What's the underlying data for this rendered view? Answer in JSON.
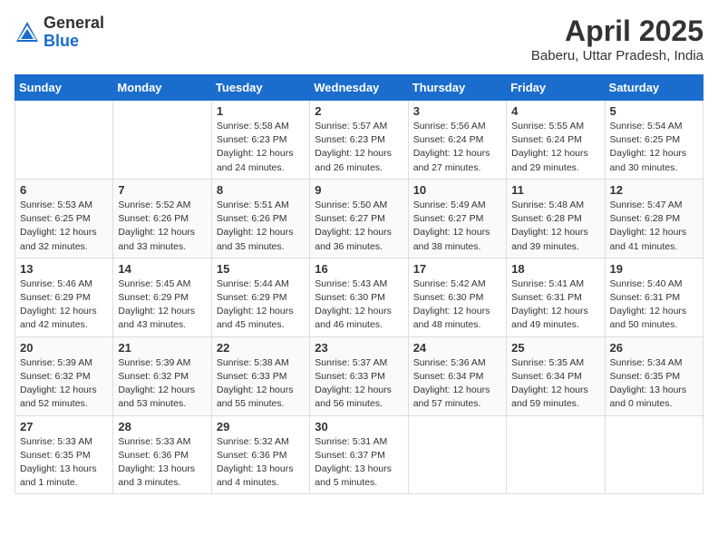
{
  "header": {
    "logo_general": "General",
    "logo_blue": "Blue",
    "title": "April 2025",
    "location": "Baberu, Uttar Pradesh, India"
  },
  "weekdays": [
    "Sunday",
    "Monday",
    "Tuesday",
    "Wednesday",
    "Thursday",
    "Friday",
    "Saturday"
  ],
  "weeks": [
    [
      {
        "day": "",
        "detail": ""
      },
      {
        "day": "",
        "detail": ""
      },
      {
        "day": "1",
        "detail": "Sunrise: 5:58 AM\nSunset: 6:23 PM\nDaylight: 12 hours\nand 24 minutes."
      },
      {
        "day": "2",
        "detail": "Sunrise: 5:57 AM\nSunset: 6:23 PM\nDaylight: 12 hours\nand 26 minutes."
      },
      {
        "day": "3",
        "detail": "Sunrise: 5:56 AM\nSunset: 6:24 PM\nDaylight: 12 hours\nand 27 minutes."
      },
      {
        "day": "4",
        "detail": "Sunrise: 5:55 AM\nSunset: 6:24 PM\nDaylight: 12 hours\nand 29 minutes."
      },
      {
        "day": "5",
        "detail": "Sunrise: 5:54 AM\nSunset: 6:25 PM\nDaylight: 12 hours\nand 30 minutes."
      }
    ],
    [
      {
        "day": "6",
        "detail": "Sunrise: 5:53 AM\nSunset: 6:25 PM\nDaylight: 12 hours\nand 32 minutes."
      },
      {
        "day": "7",
        "detail": "Sunrise: 5:52 AM\nSunset: 6:26 PM\nDaylight: 12 hours\nand 33 minutes."
      },
      {
        "day": "8",
        "detail": "Sunrise: 5:51 AM\nSunset: 6:26 PM\nDaylight: 12 hours\nand 35 minutes."
      },
      {
        "day": "9",
        "detail": "Sunrise: 5:50 AM\nSunset: 6:27 PM\nDaylight: 12 hours\nand 36 minutes."
      },
      {
        "day": "10",
        "detail": "Sunrise: 5:49 AM\nSunset: 6:27 PM\nDaylight: 12 hours\nand 38 minutes."
      },
      {
        "day": "11",
        "detail": "Sunrise: 5:48 AM\nSunset: 6:28 PM\nDaylight: 12 hours\nand 39 minutes."
      },
      {
        "day": "12",
        "detail": "Sunrise: 5:47 AM\nSunset: 6:28 PM\nDaylight: 12 hours\nand 41 minutes."
      }
    ],
    [
      {
        "day": "13",
        "detail": "Sunrise: 5:46 AM\nSunset: 6:29 PM\nDaylight: 12 hours\nand 42 minutes."
      },
      {
        "day": "14",
        "detail": "Sunrise: 5:45 AM\nSunset: 6:29 PM\nDaylight: 12 hours\nand 43 minutes."
      },
      {
        "day": "15",
        "detail": "Sunrise: 5:44 AM\nSunset: 6:29 PM\nDaylight: 12 hours\nand 45 minutes."
      },
      {
        "day": "16",
        "detail": "Sunrise: 5:43 AM\nSunset: 6:30 PM\nDaylight: 12 hours\nand 46 minutes."
      },
      {
        "day": "17",
        "detail": "Sunrise: 5:42 AM\nSunset: 6:30 PM\nDaylight: 12 hours\nand 48 minutes."
      },
      {
        "day": "18",
        "detail": "Sunrise: 5:41 AM\nSunset: 6:31 PM\nDaylight: 12 hours\nand 49 minutes."
      },
      {
        "day": "19",
        "detail": "Sunrise: 5:40 AM\nSunset: 6:31 PM\nDaylight: 12 hours\nand 50 minutes."
      }
    ],
    [
      {
        "day": "20",
        "detail": "Sunrise: 5:39 AM\nSunset: 6:32 PM\nDaylight: 12 hours\nand 52 minutes."
      },
      {
        "day": "21",
        "detail": "Sunrise: 5:39 AM\nSunset: 6:32 PM\nDaylight: 12 hours\nand 53 minutes."
      },
      {
        "day": "22",
        "detail": "Sunrise: 5:38 AM\nSunset: 6:33 PM\nDaylight: 12 hours\nand 55 minutes."
      },
      {
        "day": "23",
        "detail": "Sunrise: 5:37 AM\nSunset: 6:33 PM\nDaylight: 12 hours\nand 56 minutes."
      },
      {
        "day": "24",
        "detail": "Sunrise: 5:36 AM\nSunset: 6:34 PM\nDaylight: 12 hours\nand 57 minutes."
      },
      {
        "day": "25",
        "detail": "Sunrise: 5:35 AM\nSunset: 6:34 PM\nDaylight: 12 hours\nand 59 minutes."
      },
      {
        "day": "26",
        "detail": "Sunrise: 5:34 AM\nSunset: 6:35 PM\nDaylight: 13 hours\nand 0 minutes."
      }
    ],
    [
      {
        "day": "27",
        "detail": "Sunrise: 5:33 AM\nSunset: 6:35 PM\nDaylight: 13 hours\nand 1 minute."
      },
      {
        "day": "28",
        "detail": "Sunrise: 5:33 AM\nSunset: 6:36 PM\nDaylight: 13 hours\nand 3 minutes."
      },
      {
        "day": "29",
        "detail": "Sunrise: 5:32 AM\nSunset: 6:36 PM\nDaylight: 13 hours\nand 4 minutes."
      },
      {
        "day": "30",
        "detail": "Sunrise: 5:31 AM\nSunset: 6:37 PM\nDaylight: 13 hours\nand 5 minutes."
      },
      {
        "day": "",
        "detail": ""
      },
      {
        "day": "",
        "detail": ""
      },
      {
        "day": "",
        "detail": ""
      }
    ]
  ]
}
